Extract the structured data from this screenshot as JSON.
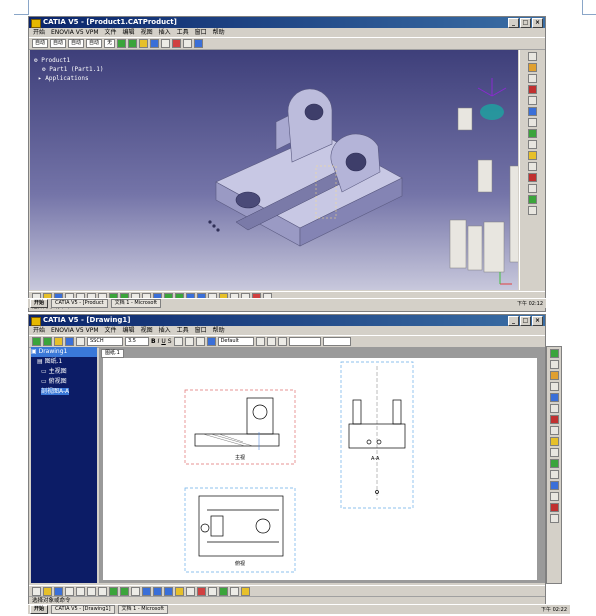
{
  "colors": {
    "title_bar": "#0a246a",
    "viewport_top": "#3e3f7a",
    "viewport_bottom": "#c8c8dc",
    "part_body": "#b8b8d8",
    "selection": "#3a78d8",
    "tree_bg": "#0c1c66",
    "view_frame_red": "#e07070",
    "view_frame_blue": "#6aaee8"
  },
  "top": {
    "title": "CATIA V5 - [Product1.CATProduct]",
    "menu": [
      "开始",
      "ENOVIA V5 VPM",
      "文件",
      "编辑",
      "视图",
      "插入",
      "工具",
      "窗口",
      "帮助"
    ],
    "combos": [
      "自动",
      "自动",
      "自动",
      "自动",
      "无"
    ],
    "tree": [
      "Product1",
      "Part1 (Part1.1)",
      "Applications"
    ],
    "status": "选择对象或命令",
    "taskbar": {
      "start": "开始",
      "task1": "CATIA V5 - [Product",
      "task2": "文档 1 - Microsoft",
      "clock": "下午 02:12"
    }
  },
  "bottom": {
    "title": "CATIA V5 - [Drawing1]",
    "menu": [
      "开始",
      "ENOVIA V5 VPM",
      "文件",
      "编辑",
      "视图",
      "插入",
      "工具",
      "窗口",
      "帮助"
    ],
    "font_combo": "SSCH",
    "size_combo": "3.5",
    "style_combo": "Default",
    "format_buttons": [
      "B",
      "I",
      "U",
      "S"
    ],
    "tree": [
      "Drawing1",
      "图纸.1",
      "主视图",
      "俯视图",
      "剖视图A-A"
    ],
    "sheet_tab": "图纸.1",
    "view_labels": [
      "主视",
      "A-A",
      "俯视"
    ],
    "status": "选择对象或命令",
    "taskbar": {
      "start": "开始",
      "task1": "CATIA V5 - [Drawing1]",
      "task2": "文档 1 - Microsoft",
      "clock": "下午 02:22"
    }
  }
}
